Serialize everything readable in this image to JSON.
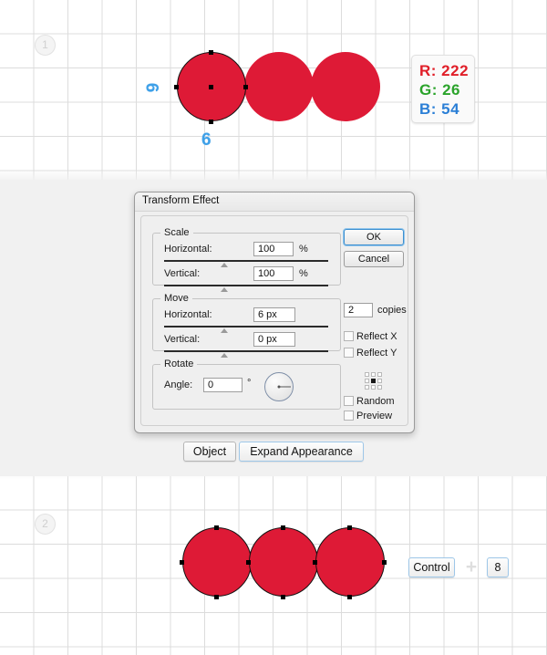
{
  "canvas": {
    "background_color": "#f1f1f1",
    "grid_color": "#dcdcdc"
  },
  "steps": [
    {
      "label": "1"
    },
    {
      "label": "2"
    }
  ],
  "artwork": {
    "shape_color": "#de1a36",
    "top": {
      "circles": [
        {
          "state": "selected"
        },
        {
          "state": "effect-copy"
        },
        {
          "state": "effect-copy"
        }
      ]
    },
    "bottom": {
      "circles": [
        {
          "state": "expanded"
        },
        {
          "state": "expanded"
        },
        {
          "state": "expanded"
        }
      ]
    },
    "annotations": [
      {
        "value": "6",
        "orientation": "rotated"
      },
      {
        "value": "6",
        "orientation": "upright"
      }
    ]
  },
  "color_swatch": {
    "r_label": "R: 222",
    "g_label": "G: 26",
    "b_label": "B: 54",
    "r_color": "#e01e28",
    "g_color": "#2aa32a",
    "b_color": "#2b7fd6"
  },
  "dialog": {
    "title": "Transform Effect",
    "scale": {
      "legend": "Scale",
      "horizontal_label": "Horizontal:",
      "horizontal_value": "100",
      "horizontal_unit": "%",
      "vertical_label": "Vertical:",
      "vertical_value": "100",
      "vertical_unit": "%"
    },
    "move": {
      "legend": "Move",
      "horizontal_label": "Horizontal:",
      "horizontal_value": "6 px",
      "vertical_label": "Vertical:",
      "vertical_value": "0 px"
    },
    "rotate": {
      "legend": "Rotate",
      "angle_label": "Angle:",
      "angle_value": "0",
      "angle_unit": "°"
    },
    "buttons": {
      "ok": "OK",
      "cancel": "Cancel"
    },
    "copies": {
      "value": "2",
      "label": "copies"
    },
    "options": {
      "reflect_x": "Reflect X",
      "reflect_y": "Reflect Y",
      "random": "Random",
      "preview": "Preview"
    },
    "reference_point": {
      "selected": "center"
    }
  },
  "toolbar": {
    "object_label": "Object",
    "expand_label": "Expand Appearance"
  },
  "shortcut": {
    "modifier": "Control",
    "plus": "+",
    "key": "8"
  }
}
